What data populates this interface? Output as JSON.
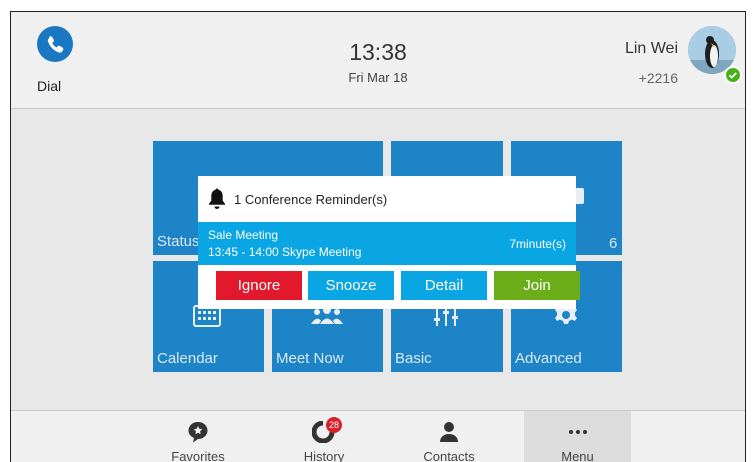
{
  "header": {
    "dial_label": "Dial",
    "time": "13:38",
    "date": "Fri Mar 18",
    "user_name": "Lin Wei",
    "user_ext": "+2216"
  },
  "tiles": {
    "status": "Status",
    "six": "6",
    "calendar": "Calendar",
    "meet_now": "Meet Now",
    "basic": "Basic",
    "advanced": "Advanced"
  },
  "popup": {
    "title": "1 Conference Reminder(s)",
    "meeting_name": "Sale Meeting",
    "meeting_time": "13:45 - 14:00 Skype Meeting",
    "countdown": "7minute(s)",
    "buttons": {
      "ignore": "Ignore",
      "snooze": "Snooze",
      "detail": "Detail",
      "join": "Join"
    }
  },
  "bottom_nav": {
    "favorites": "Favorites",
    "history": "History",
    "history_badge": "28",
    "contacts": "Contacts",
    "menu": "Menu"
  },
  "colors": {
    "tile": "#1d84c8",
    "reminder_strip": "#0aa6e4",
    "ignore": "#e2192c",
    "snooze": "#0aa6e4",
    "detail": "#0aa6e4",
    "join": "#6bae1a",
    "presence": "#47b11a"
  }
}
